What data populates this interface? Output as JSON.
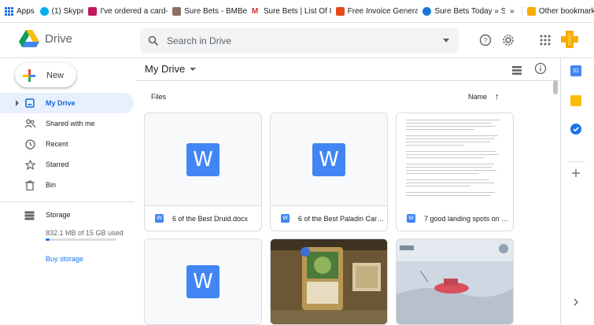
{
  "bookmarks": [
    {
      "label": "Apps",
      "icon": "apps-grid-icon"
    },
    {
      "label": "(1) Skype",
      "icon": "skype-icon",
      "color": "#00aff0"
    },
    {
      "label": "I've ordered a card-...",
      "icon": "bookmark-icon",
      "color": "#c2185b"
    },
    {
      "label": "Sure Bets - BMBets",
      "icon": "bmbets-icon",
      "color": "#8d6e63"
    },
    {
      "label": "Sure Bets | List Of I...",
      "icon": "m-icon",
      "color": "#d32f2f"
    },
    {
      "label": "Free Invoice Genera...",
      "icon": "invoice-icon",
      "color": "#e64a19"
    },
    {
      "label": "Sure Bets Today » S...",
      "icon": "surebets-icon",
      "color": "#1976d2"
    }
  ],
  "bookmarks_more": "»",
  "other_bookmarks": "Other bookmarks",
  "app": {
    "name": "Drive"
  },
  "search": {
    "placeholder": "Search in Drive"
  },
  "new_button": "New",
  "nav": [
    {
      "label": "My Drive",
      "icon": "my-drive-icon",
      "active": true
    },
    {
      "label": "Shared with me",
      "icon": "shared-icon"
    },
    {
      "label": "Recent",
      "icon": "clock-icon"
    },
    {
      "label": "Starred",
      "icon": "star-icon"
    },
    {
      "label": "Bin",
      "icon": "bin-icon"
    }
  ],
  "storage": {
    "label": "Storage",
    "used_text": "832.1 MB of 15 GB used",
    "used_fraction": 0.054,
    "buy": "Buy storage"
  },
  "main": {
    "title": "My Drive",
    "files_label": "Files",
    "sort_label": "Name",
    "sort_arrow": "↑"
  },
  "files": [
    {
      "name": "6 of the Best Druid.docx",
      "type": "word"
    },
    {
      "name": "6 of the Best Paladin Card...",
      "type": "word"
    },
    {
      "name": "7 good landing spots on P...",
      "type": "doc-preview"
    },
    {
      "name": "",
      "type": "word"
    },
    {
      "name": "",
      "type": "image-card-game"
    },
    {
      "name": "",
      "type": "image-game"
    }
  ],
  "colors": {
    "accent": "#1a73e8",
    "active_bg": "#e8f0fe",
    "word_blue": "#4285f4"
  }
}
